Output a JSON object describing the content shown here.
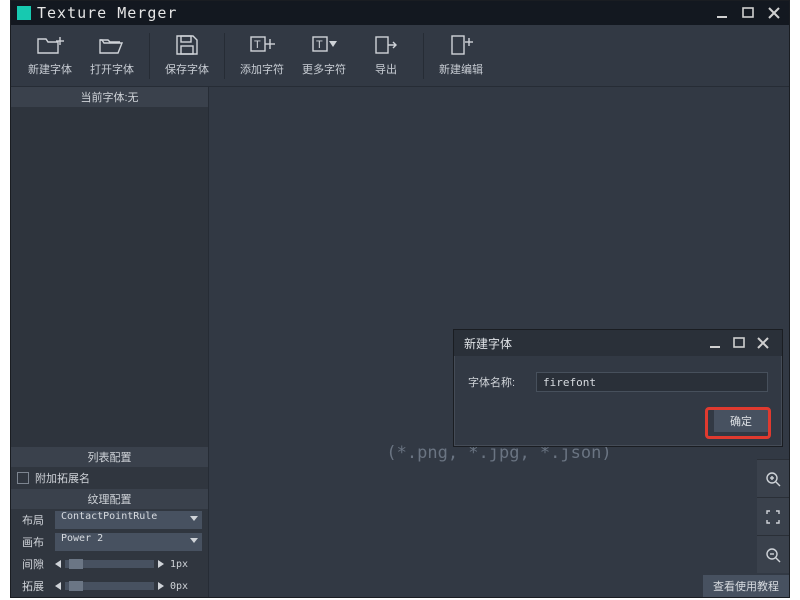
{
  "window": {
    "title": "Texture Merger"
  },
  "toolbar": {
    "new_font": "新建字体",
    "open_font": "打开字体",
    "save_font": "保存字体",
    "add_char": "添加字符",
    "more_char": "更多字符",
    "export": "导出",
    "new_edit": "新建编辑"
  },
  "sidebar": {
    "current_font_label": "当前字体:无",
    "list_config_title": "列表配置",
    "append_ext_label": "附加拓展名",
    "texture_config_title": "纹理配置",
    "layout_label": "布局",
    "layout_value": "ContactPointRule",
    "canvas_label": "画布",
    "canvas_value": "Power 2",
    "gap_label": "间隙",
    "gap_value": "1px",
    "expand_label": "拓展",
    "expand_value": "0px"
  },
  "canvas": {
    "hint": "(*.png, *.jpg, *.json)"
  },
  "footer": {
    "tutorial_btn": "查看使用教程"
  },
  "dialog": {
    "title": "新建字体",
    "name_label": "字体名称:",
    "name_value": "firefont",
    "ok": "确定"
  }
}
